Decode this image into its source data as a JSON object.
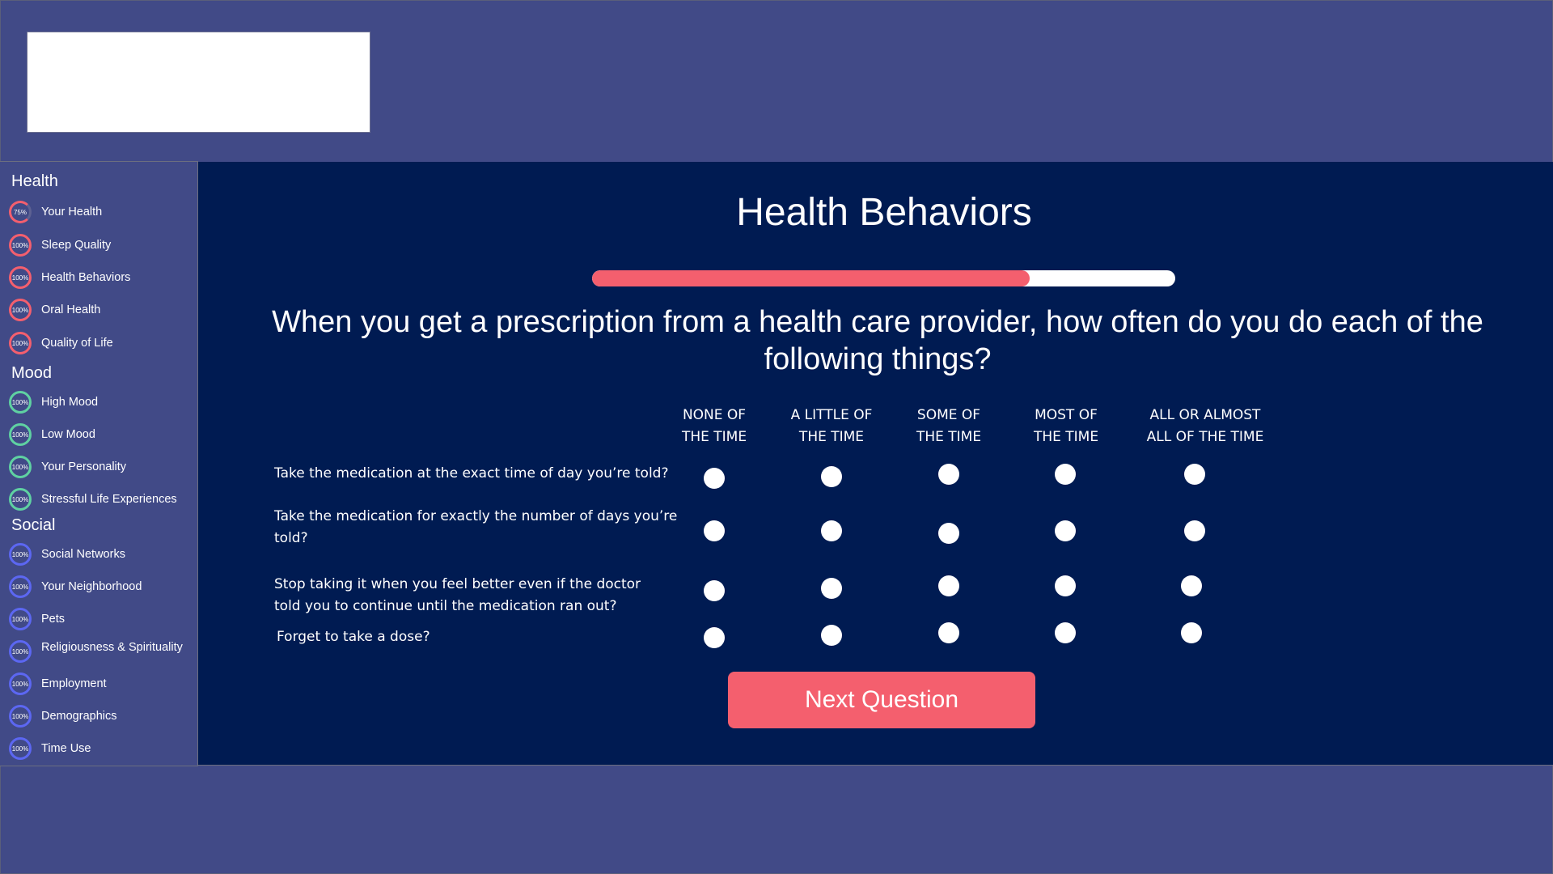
{
  "sidebar": {
    "sections": [
      {
        "title": "Health",
        "color": "#f45f6e",
        "items": [
          {
            "label": "Your Health",
            "percent": "75%"
          },
          {
            "label": "Sleep Quality",
            "percent": "100%"
          },
          {
            "label": "Health Behaviors",
            "percent": "100%"
          },
          {
            "label": "Oral Health",
            "percent": "100%"
          },
          {
            "label": "Quality of Life",
            "percent": "100%"
          }
        ]
      },
      {
        "title": "Mood",
        "color": "#5fd1a2",
        "items": [
          {
            "label": "High Mood",
            "percent": "100%"
          },
          {
            "label": "Low Mood",
            "percent": "100%"
          },
          {
            "label": "Your Personality",
            "percent": "100%"
          },
          {
            "label": "Stressful Life Experiences",
            "percent": "100%"
          }
        ]
      },
      {
        "title": "Social",
        "color": "#5c67f2",
        "items": [
          {
            "label": "Social Networks",
            "percent": "100%"
          },
          {
            "label": "Your Neighborhood",
            "percent": "100%"
          },
          {
            "label": "Pets",
            "percent": "100%"
          },
          {
            "label": "Religiousness & Spirituality",
            "percent": "100%"
          },
          {
            "label": "Employment",
            "percent": "100%"
          },
          {
            "label": "Demographics",
            "percent": "100%"
          },
          {
            "label": "Time Use",
            "percent": "100%"
          }
        ]
      }
    ]
  },
  "main": {
    "title": "Health Behaviors",
    "progress": 0.75,
    "question": "When you get a prescription from a health care provider, how often do you do each of the following things?",
    "columns": [
      {
        "line1": "NONE OF",
        "line2": "THE TIME"
      },
      {
        "line1": "A LITTLE OF",
        "line2": "THE TIME"
      },
      {
        "line1": "SOME OF",
        "line2": "THE TIME"
      },
      {
        "line1": "MOST OF",
        "line2": "THE TIME"
      },
      {
        "line1": "ALL OR ALMOST",
        "line2": "ALL OF THE TIME"
      }
    ],
    "rows": [
      {
        "line1": "Take the medication at the exact time of day you’re told?",
        "line2": ""
      },
      {
        "line1": "Take the medication for exactly the number of days you’re",
        "line2": "told?"
      },
      {
        "line1": "Stop taking it when you feel better even if the doctor",
        "line2": "told you to continue until the medication ran out?"
      },
      {
        "line1": "Forget to take a dose?",
        "line2": ""
      }
    ],
    "next_label": "Next Question"
  },
  "colors": {
    "background": "#414a87",
    "main_panel": "#001b52",
    "accent": "#f45f6e",
    "health_ring": "#f45f6e",
    "mood_ring": "#5fd1a2",
    "social_ring": "#5c67f2"
  }
}
